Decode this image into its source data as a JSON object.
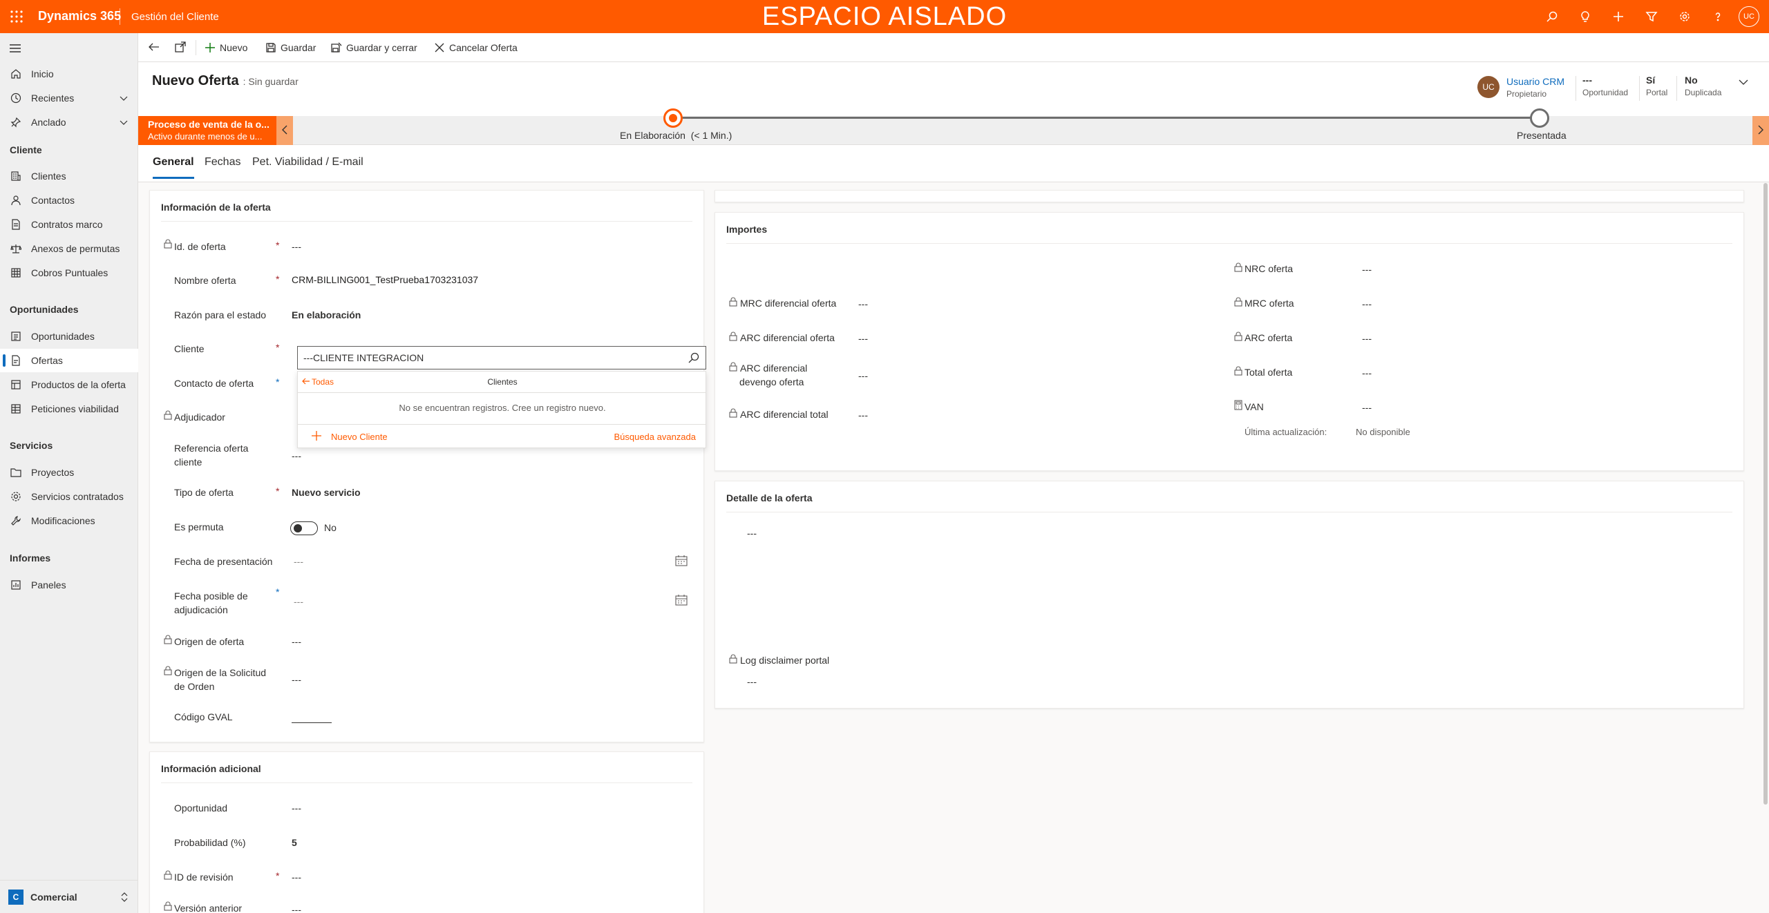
{
  "topbar": {
    "app_name": "Dynamics 365",
    "module_name": "Gestión del Cliente",
    "sandbox_label": "ESPACIO AISLADO",
    "user_initials": "UC",
    "icons": [
      "search-icon",
      "lightbulb-icon",
      "plus-icon",
      "filter-icon",
      "gear-icon",
      "help-icon"
    ]
  },
  "sidebar": {
    "items_top": [
      {
        "label": "Inicio",
        "icon": "home-icon"
      },
      {
        "label": "Recientes",
        "icon": "clock-icon"
      },
      {
        "label": "Anclado",
        "icon": "pin-icon"
      }
    ],
    "groups": [
      {
        "title": "Cliente",
        "items": [
          "Clientes",
          "Contactos",
          "Contratos marco",
          "Anexos de permutas",
          "Cobros Puntuales"
        ]
      },
      {
        "title": "Oportunidades",
        "items": [
          "Oportunidades",
          "Ofertas",
          "Productos de la oferta",
          "Peticiones viabilidad"
        ]
      },
      {
        "title": "Servicios",
        "items": [
          "Proyectos",
          "Servicios contratados",
          "Modificaciones"
        ]
      },
      {
        "title": "Informes",
        "items": [
          "Paneles"
        ]
      }
    ],
    "active_item": "Ofertas",
    "area": {
      "badge": "C",
      "label": "Comercial"
    }
  },
  "commands": {
    "new": "Nuevo",
    "save": "Guardar",
    "save_close": "Guardar y cerrar",
    "cancel_offer": "Cancelar Oferta"
  },
  "header": {
    "title": "Nuevo Oferta",
    "status": ": Sin guardar",
    "owner_initials": "UC",
    "owner_name": "Usuario CRM",
    "owner_label": "Propietario",
    "fields": [
      {
        "value": "---",
        "label": "Oportunidad"
      },
      {
        "value": "Sí",
        "label": "Portal"
      },
      {
        "value": "No",
        "label": "Duplicada"
      }
    ]
  },
  "bpf": {
    "process_name": "Proceso de venta de la o...",
    "process_sub": "Activo durante menos de u...",
    "stage_active": "En Elaboración",
    "stage_active_time": "(< 1 Min.)",
    "stage_next": "Presentada"
  },
  "tabs": [
    "General",
    "Fechas",
    "Pet. Viabilidad / E-mail"
  ],
  "offer_info": {
    "title": "Información de la oferta",
    "id_label": "Id. de oferta",
    "id_value": "---",
    "name_label": "Nombre oferta",
    "name_value": "CRM-BILLING001_TestPrueba1703231037",
    "reason_label": "Razón para el estado",
    "reason_value": "En elaboración",
    "client_label": "Cliente",
    "client_value": "---CLIENTE INTEGRACION",
    "contact_label": "Contacto de oferta",
    "awarder_label": "Adjudicador",
    "ref_label_1": "Referencia oferta",
    "ref_label_2": "cliente",
    "ref_value": "---",
    "type_label": "Tipo de oferta",
    "type_value": "Nuevo servicio",
    "swap_label": "Es permuta",
    "swap_value": "No",
    "pres_date_label": "Fecha de presentación",
    "pres_date_value": "---",
    "adj_date_label_1": "Fecha posible de",
    "adj_date_label_2": "adjudicación",
    "adj_date_value": "---",
    "origin_label": "Origen de oferta",
    "origin_value": "---",
    "order_origin_label_1": "Origen de la Solicitud",
    "order_origin_label_2": "de Orden",
    "order_origin_value": "---",
    "gval_label": "Código GVAL",
    "gval_value": ""
  },
  "dropdown": {
    "back_label": "Todas",
    "entity_label": "Clientes",
    "empty_message": "No se encuentran registros. Cree un registro nuevo.",
    "new_label": "Nuevo Cliente",
    "advanced_label": "Búsqueda avanzada"
  },
  "extra_info": {
    "title": "Información adicional",
    "opp_label": "Oportunidad",
    "opp_value": "---",
    "prob_label": "Probabilidad (%)",
    "prob_value": "5",
    "rev_label": "ID de revisión",
    "rev_value": "---",
    "prev_label": "Versión anterior",
    "prev_value": "---"
  },
  "amounts": {
    "title": "Importes",
    "left": [
      {
        "label": "MRC diferencial oferta",
        "value": "---"
      },
      {
        "label": "ARC diferencial oferta",
        "value": "---"
      },
      {
        "label_1": "ARC diferencial",
        "label_2": "devengo oferta",
        "value": "---"
      },
      {
        "label": "ARC diferencial total",
        "value": "---"
      }
    ],
    "right": [
      {
        "label": "NRC oferta",
        "value": "---"
      },
      {
        "label": "MRC oferta",
        "value": "---"
      },
      {
        "label": "ARC oferta",
        "value": "---"
      },
      {
        "label": "Total oferta",
        "value": "---"
      },
      {
        "label": "VAN",
        "value": "---"
      }
    ],
    "last_update_label": "Última actualización:",
    "last_update_value": "No disponible"
  },
  "detail": {
    "title": "Detalle de la oferta",
    "value": "---",
    "log_label": "Log disclaimer portal",
    "log_value": "---"
  },
  "colors": {
    "brand": "#ff5a00",
    "accent": "#0f6cbd",
    "required": "#a4262c",
    "owner_avatar": "#8e562e"
  }
}
